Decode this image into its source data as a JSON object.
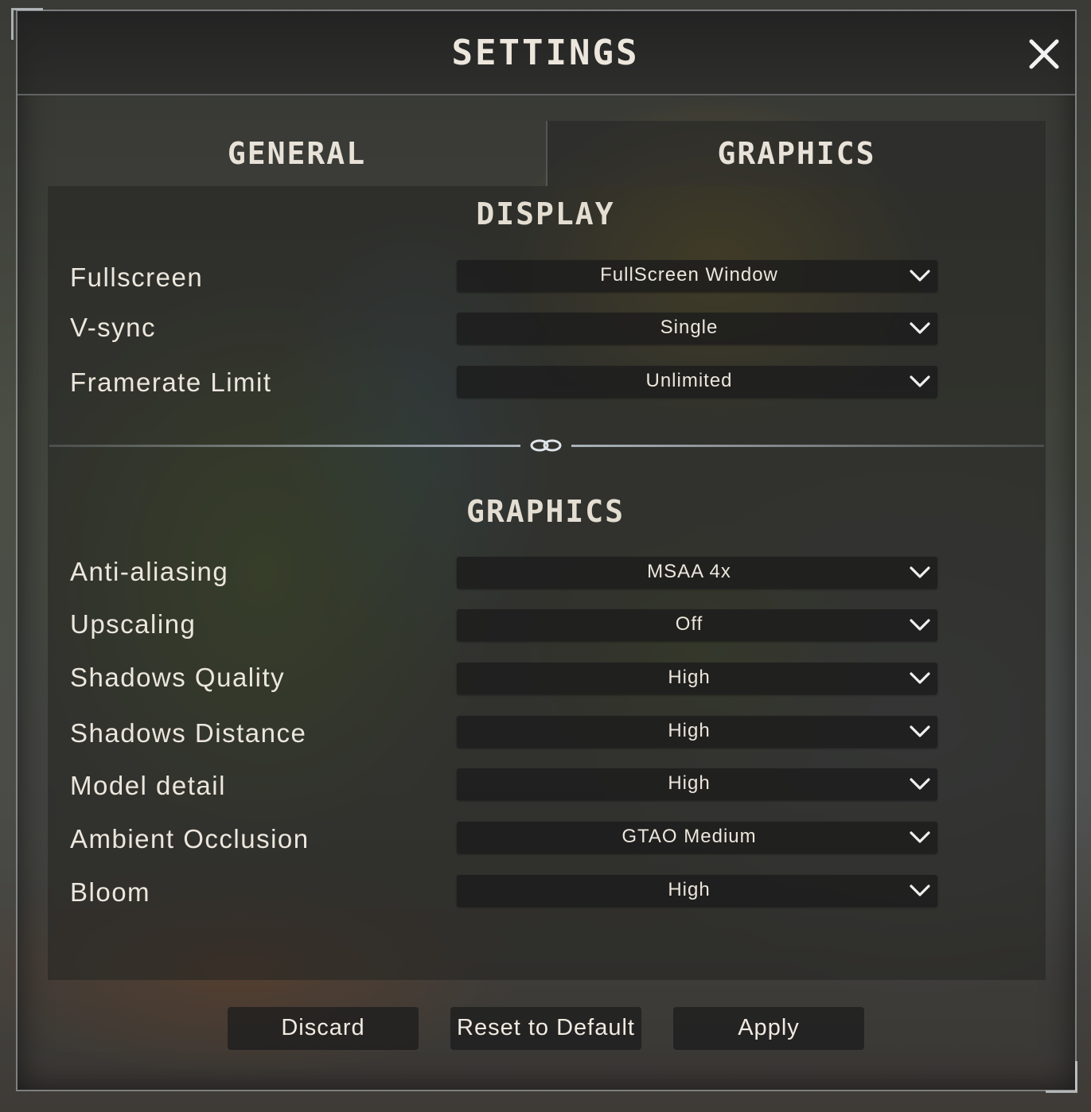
{
  "window": {
    "title": "SETTINGS",
    "close_icon": "close-icon"
  },
  "tabs": [
    {
      "label": "GENERAL",
      "active": false
    },
    {
      "label": "GRAPHICS",
      "active": true
    }
  ],
  "sections": {
    "display": {
      "title": "DISPLAY",
      "rows": [
        {
          "label": "Fullscreen",
          "value": "FullScreen Window"
        },
        {
          "label": "V-sync",
          "value": "Single"
        },
        {
          "label": "Framerate Limit",
          "value": "Unlimited"
        }
      ]
    },
    "graphics": {
      "title": "GRAPHICS",
      "rows": [
        {
          "label": "Anti-aliasing",
          "value": "MSAA 4x"
        },
        {
          "label": "Upscaling",
          "value": "Off"
        },
        {
          "label": "Shadows Quality",
          "value": "High"
        },
        {
          "label": "Shadows Distance",
          "value": "High"
        },
        {
          "label": "Model detail",
          "value": "High"
        },
        {
          "label": "Ambient Occlusion",
          "value": "GTAO Medium"
        },
        {
          "label": "Bloom",
          "value": "High"
        }
      ]
    }
  },
  "footer": {
    "discard_label": "Discard",
    "reset_label": "Reset to Default",
    "apply_label": "Apply"
  },
  "colors": {
    "text": "#ece6dc",
    "dropdown_bg": "#1c1c1c",
    "panel_bg": "#262624"
  }
}
